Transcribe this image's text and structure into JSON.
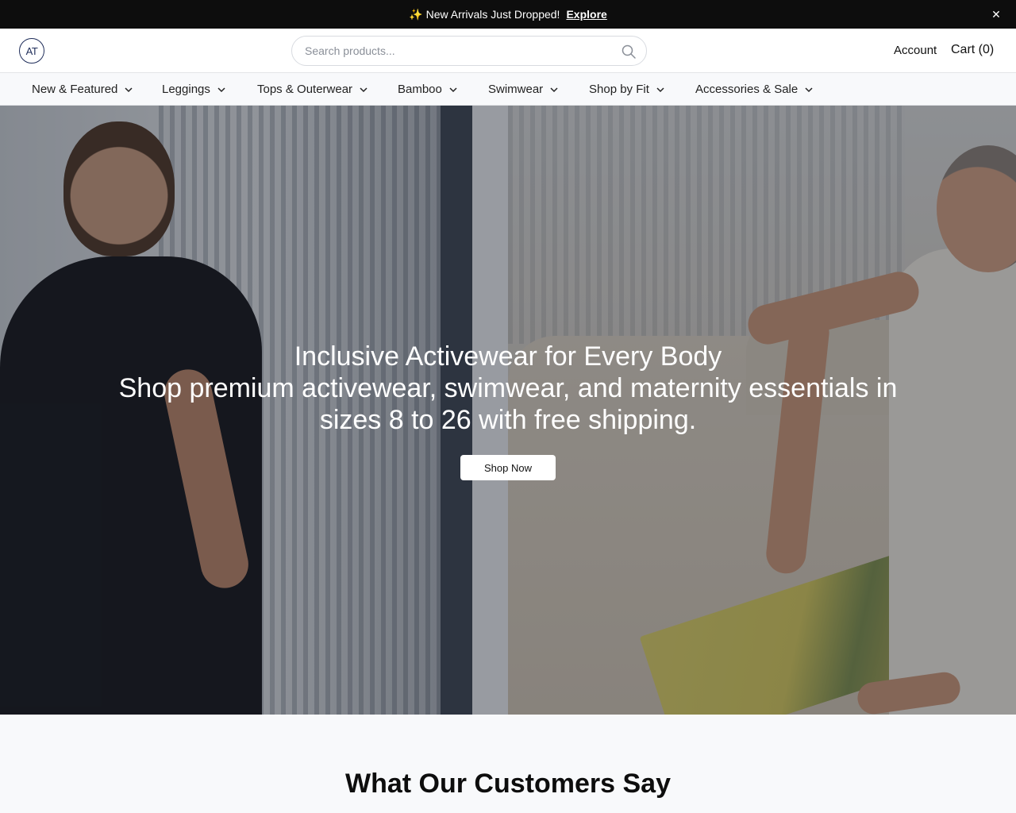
{
  "announcement": {
    "icon": "sparkle-icon",
    "text": "New Arrivals Just Dropped!",
    "link_label": "Explore",
    "close_label": "✕"
  },
  "header": {
    "logo_text": "AT",
    "search_placeholder": "Search products...",
    "search_value": "",
    "account_label": "Account",
    "cart_label": "Cart (0)"
  },
  "nav": {
    "items": [
      {
        "label": "New & Featured"
      },
      {
        "label": "Leggings"
      },
      {
        "label": "Tops & Outerwear"
      },
      {
        "label": "Bamboo"
      },
      {
        "label": "Swimwear"
      },
      {
        "label": "Shop by Fit"
      },
      {
        "label": "Accessories & Sale"
      }
    ]
  },
  "hero": {
    "title": "Inclusive Activewear for Every Body",
    "subtitle": "Shop premium activewear, swimwear, and maternity essentials in sizes 8 to 26 with free shipping.",
    "cta_label": "Shop Now"
  },
  "testimonials": {
    "title": "What Our Customers Say"
  }
}
